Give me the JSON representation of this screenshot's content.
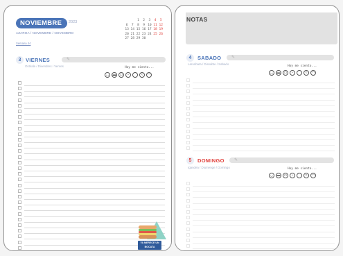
{
  "left_page": {
    "month_title": "NOVIEMBRE",
    "year": "2023",
    "month_subtitle": "AZAROA / NOVEMBRE / NOVEMBRO",
    "week_label": "Semana 44",
    "mini_calendar": [
      [
        "",
        "",
        "1",
        "2",
        "3",
        "4",
        "5"
      ],
      [
        "6",
        "7",
        "8",
        "9",
        "10",
        "11",
        "12"
      ],
      [
        "13",
        "14",
        "15",
        "16",
        "17",
        "18",
        "19"
      ],
      [
        "20",
        "21",
        "22",
        "23",
        "24",
        "25",
        "26"
      ],
      [
        "27",
        "28",
        "29",
        "30",
        "",
        "",
        ""
      ]
    ],
    "day": {
      "number": "3",
      "name": "VIERNES",
      "subtitle": "Ostirala / Divendres / Venres",
      "mood_label": "Hoy me siento...",
      "color": "#4a74b8"
    },
    "sticker_text": "YA MERECE UN BOCATA"
  },
  "right_page": {
    "notes_title": "NOTAS",
    "days": [
      {
        "number": "4",
        "name": "SABADO",
        "subtitle": "Larunbata / Dissabte / Sabado",
        "mood_label": "Hoy me siento...",
        "color": "#4a74b8"
      },
      {
        "number": "5",
        "name": "DOMINGO",
        "subtitle": "Igandea / Diumenge / Domingo",
        "mood_label": "Hoy me siento...",
        "color": "#e0413c"
      }
    ]
  },
  "mood_icons": [
    "relaxed-face-icon",
    "cool-face-icon",
    "sick-face-icon",
    "neutral-face-icon",
    "sad-face-icon",
    "angry-face-icon",
    "happy-face-icon"
  ],
  "colors": {
    "accent_blue": "#4a74b8",
    "accent_red": "#e0413c",
    "sticker_teal": "#8fd3c6"
  }
}
